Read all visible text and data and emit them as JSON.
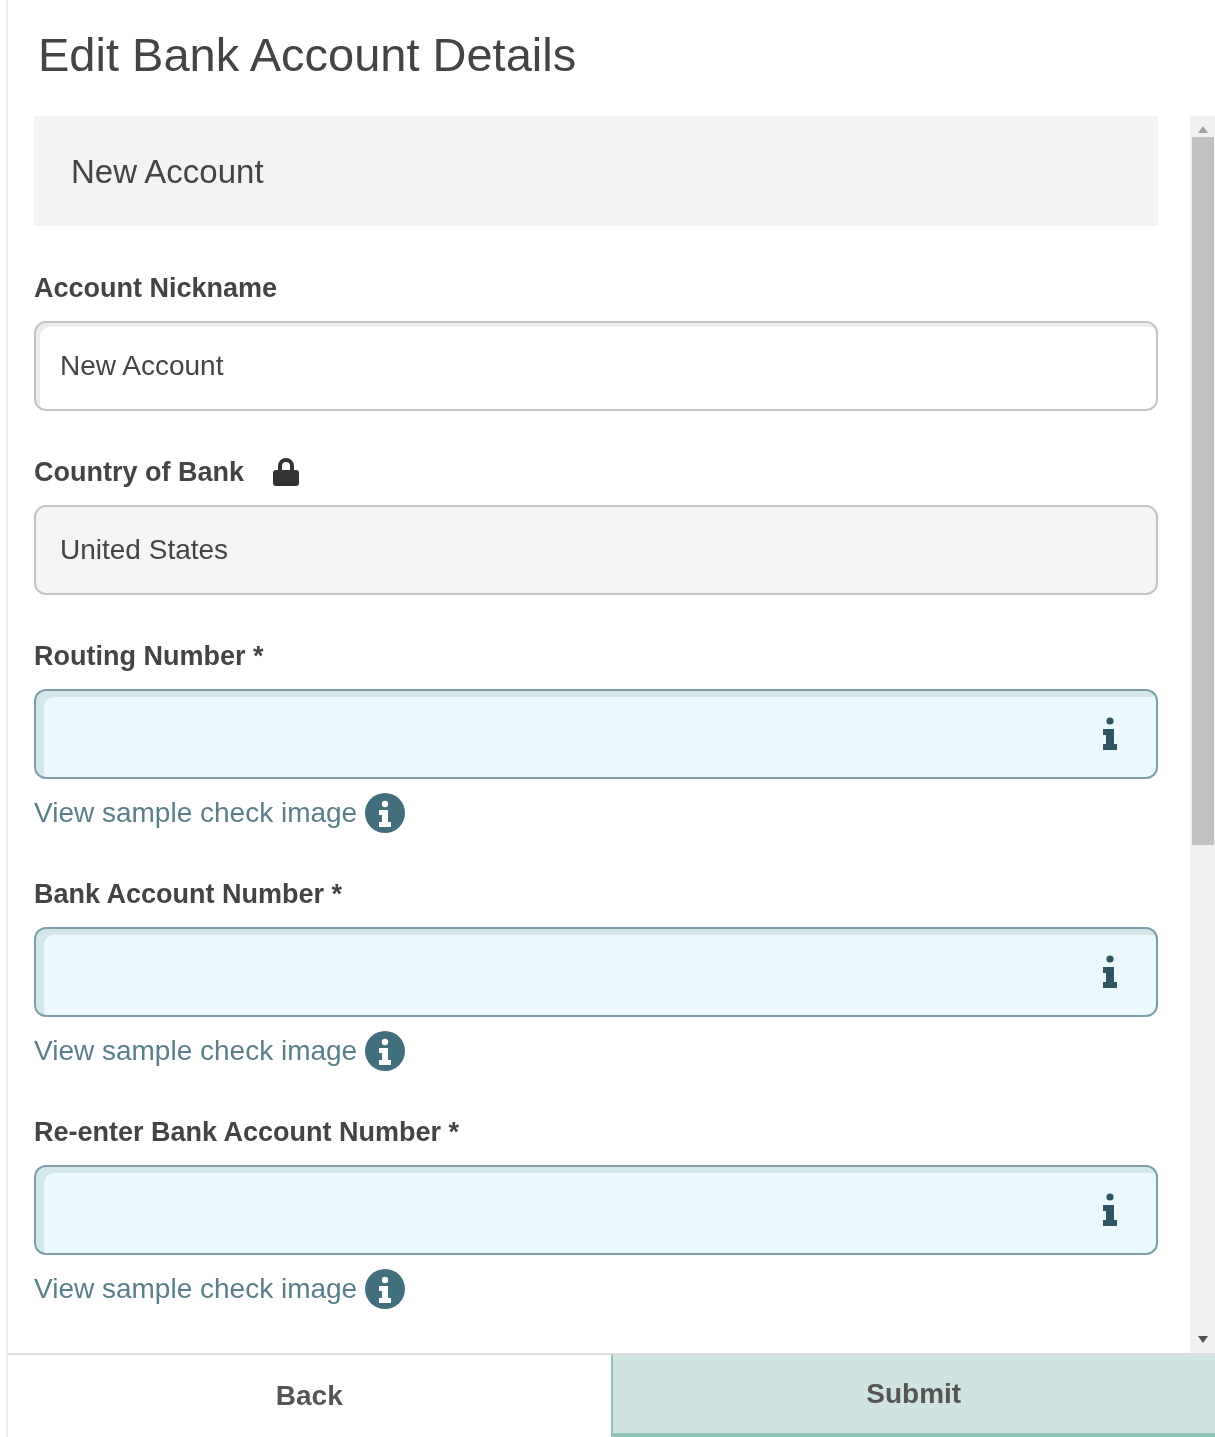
{
  "title": "Edit Bank Account Details",
  "section": {
    "title": "New Account"
  },
  "fields": [
    {
      "kind": "text",
      "label": "Account Nickname",
      "value": "New Account",
      "locked": false
    },
    {
      "kind": "readonly",
      "label": "Country of Bank",
      "value": "United States",
      "locked": true
    },
    {
      "kind": "help",
      "label": "Routing Number *",
      "link": "View sample check image",
      "locked": false
    },
    {
      "kind": "help",
      "label": "Bank Account Number *",
      "link": "View sample check image",
      "locked": false
    },
    {
      "kind": "help",
      "label": "Re-enter Bank Account Number *",
      "link": "View sample check image",
      "locked": false
    }
  ],
  "buttons": [
    {
      "label": "Back",
      "kind": "secondary"
    },
    {
      "label": "Submit",
      "kind": "primary"
    }
  ]
}
